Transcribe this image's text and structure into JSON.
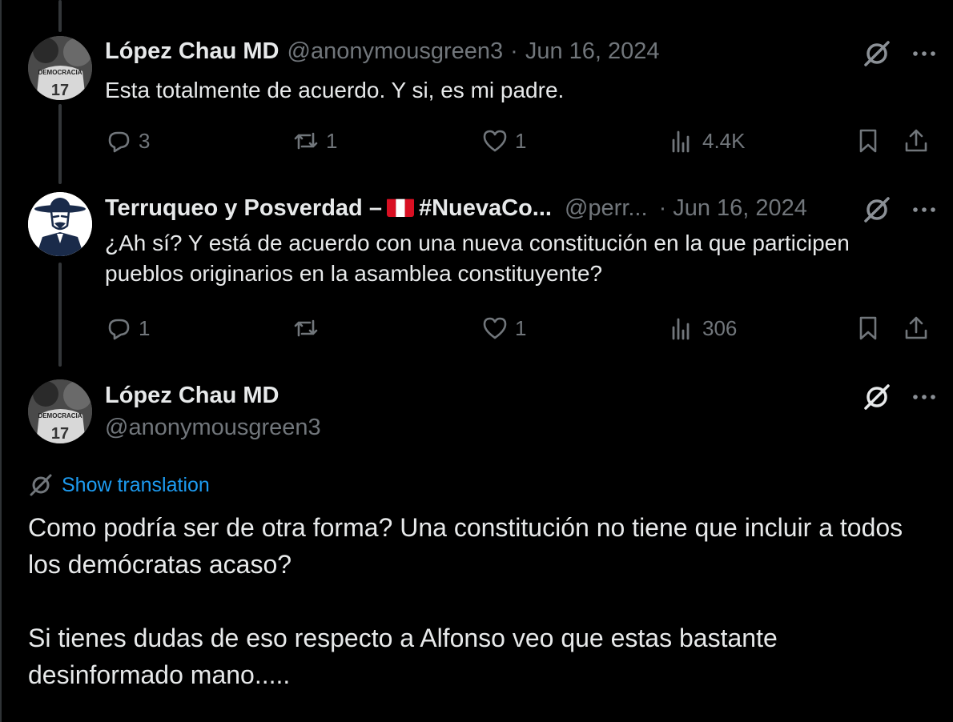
{
  "replies": [
    {
      "name": "López Chau MD",
      "handle": "@anonymousgreen3",
      "separator": "·",
      "date": "Jun 16, 2024",
      "text": "Esta totalmente de acuerdo.  Y si, es mi padre.",
      "stats": {
        "replies": "3",
        "reposts": "1",
        "likes": "1",
        "views": "4.4K"
      }
    },
    {
      "name_prefix": "Terruqueo y Posverdad –",
      "name_suffix": "#NuevaCo...",
      "handle": "@perr...",
      "separator": "·",
      "date": "Jun 16, 2024",
      "text_lines": [
        "¿Ah sí? Y está de acuerdo con una nueva constitución en la que participen",
        "pueblos originarios en la asamblea constituyente?"
      ],
      "stats": {
        "replies": "1",
        "reposts": "",
        "likes": "1",
        "views": "306"
      }
    }
  ],
  "main_post": {
    "name": "López Chau MD",
    "handle": "@anonymousgreen3",
    "show_translation": "Show translation",
    "paragraphs": [
      "Como podría ser de otra forma?  Una constitución no tiene que incluir a todos los demócratas acaso?",
      "Si tienes dudas de eso respecto a Alfonso veo que estas bastante desinformado mano....."
    ]
  },
  "avatar_photo_text": "DEMOCRACIA",
  "colors": {
    "background": "#000000",
    "text": "#e7e9ea",
    "muted": "#71767b",
    "link": "#1d9bf0",
    "thread_line": "#333639"
  },
  "icons": [
    "reply-icon",
    "repost-icon",
    "like-icon",
    "views-icon",
    "bookmark-icon",
    "share-icon",
    "grok-icon",
    "more-icon",
    "translate-icon",
    "peru-flag-icon"
  ]
}
